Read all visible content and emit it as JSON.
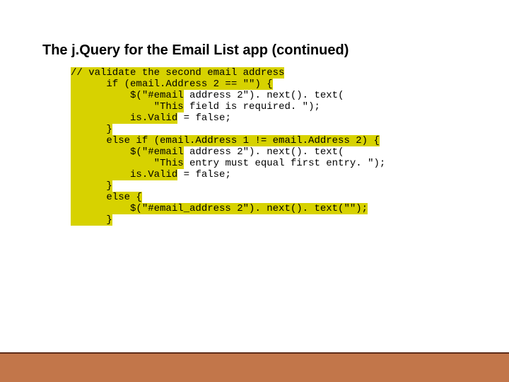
{
  "title": "The j.Query for the Email List app (continued)",
  "code": {
    "c1": "// validate the second email address",
    "i2": "      if (email.Address 2 == \"\") {",
    "i3a": "          $(\"#email",
    "i3b": " address 2\"). next(). text(",
    "i4a": "              \"This",
    "i4b": " field is required. \");",
    "i5a": "          is.Valid",
    "i5b": " = false;",
    "i6": "      }",
    "i7": "      else if (email.Address 1 != email.Address 2) {",
    "i8a": "          $(\"#email",
    "i8b": " address 2\"). next(). text(",
    "i9a": "              \"This",
    "i9b": " entry must equal first entry. \");",
    "i10a": "          is.Valid",
    "i10b": " = false;",
    "i11": "      }",
    "i12": "      else {",
    "i13": "          $(\"#email_address 2\"). next(). text(\"\");",
    "i14": "      }"
  }
}
